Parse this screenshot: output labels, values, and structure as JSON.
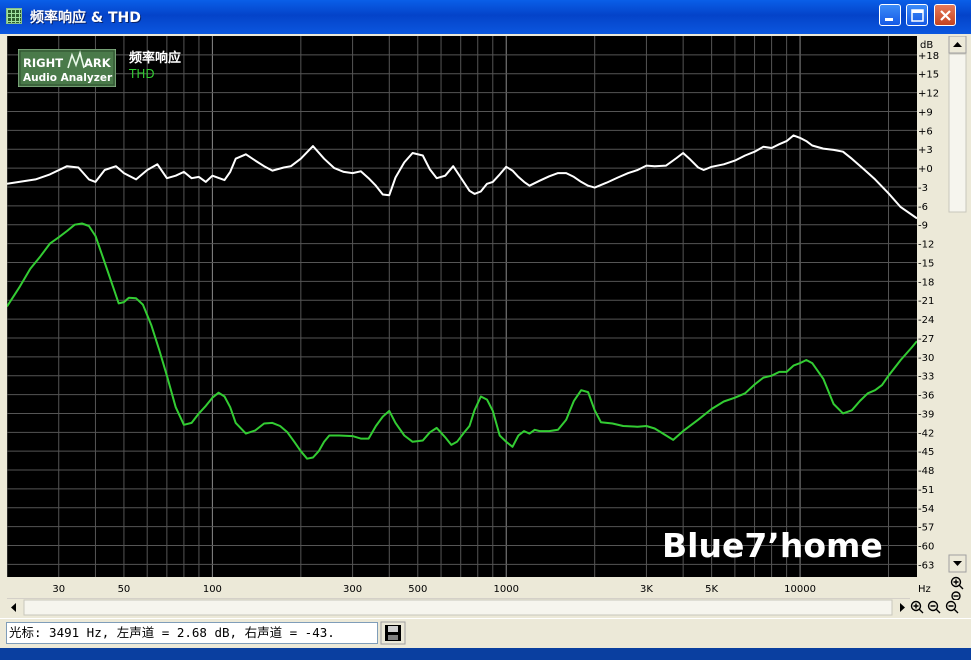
{
  "window": {
    "title": "频率响应 & THD",
    "buttons": {
      "minimize": "minimize",
      "maximize": "maximize",
      "close": "close"
    }
  },
  "logo": {
    "line1_a": "RIGHT",
    "line1_b": "ARK",
    "line2": "Audio Analyzer"
  },
  "watermark": "Blue7’home",
  "legend": {
    "fr_label": "频率响应",
    "thd_label": "THD"
  },
  "status": {
    "readout": "光标:  3491 Hz, 左声道 = 2.68 dB, 右声道 = -43.",
    "save_icon": "floppy-disk-icon"
  },
  "colors": {
    "background": "#000000",
    "grid": "#5a5a5a",
    "fr": "#ffffff",
    "thd": "#33cc33",
    "titlebar": "#0A5FE8"
  },
  "chart_data": {
    "type": "line",
    "x_scale": "log",
    "xlim": [
      20,
      25000
    ],
    "ylim": [
      -65,
      21
    ],
    "y_unit_label": "dB",
    "x_unit_label": "Hz",
    "grid": true,
    "x_tick_labels": [
      {
        "v": 30,
        "t": "30"
      },
      {
        "v": 50,
        "t": "50"
      },
      {
        "v": 100,
        "t": "100"
      },
      {
        "v": 300,
        "t": "300"
      },
      {
        "v": 500,
        "t": "500"
      },
      {
        "v": 1000,
        "t": "1000"
      },
      {
        "v": 3000,
        "t": "3K"
      },
      {
        "v": 5000,
        "t": "5K"
      },
      {
        "v": 10000,
        "t": "10000"
      }
    ],
    "y_tick_labels": [
      "+18",
      "+15",
      "+12",
      "+9",
      "+6",
      "+3",
      "+0",
      "-3",
      "-6",
      "-9",
      "-12",
      "-15",
      "-18",
      "-21",
      "-24",
      "-27",
      "-30",
      "-33",
      "-36",
      "-39",
      "-42",
      "-45",
      "-48",
      "-51",
      "-54",
      "-57",
      "-60",
      "-63"
    ],
    "y_tick_values": [
      18,
      15,
      12,
      9,
      6,
      3,
      0,
      -3,
      -6,
      -9,
      -12,
      -15,
      -18,
      -21,
      -24,
      -27,
      -30,
      -33,
      -36,
      -39,
      -42,
      -45,
      -48,
      -51,
      -54,
      -57,
      -60,
      -63
    ],
    "series": [
      {
        "name": "频率响应",
        "color": "#ffffff",
        "points": [
          [
            20,
            -2.5
          ],
          [
            25,
            -1.8
          ],
          [
            28,
            -1.0
          ],
          [
            32,
            0.3
          ],
          [
            35,
            0.1
          ],
          [
            38,
            -1.8
          ],
          [
            40,
            -2.2
          ],
          [
            43,
            -0.3
          ],
          [
            47,
            0.3
          ],
          [
            50,
            -0.8
          ],
          [
            55,
            -1.8
          ],
          [
            60,
            -0.3
          ],
          [
            65,
            0.6
          ],
          [
            70,
            -1.6
          ],
          [
            75,
            -1.2
          ],
          [
            80,
            -0.6
          ],
          [
            85,
            -1.6
          ],
          [
            90,
            -1.4
          ],
          [
            95,
            -2.2
          ],
          [
            100,
            -1.2
          ],
          [
            110,
            -1.9
          ],
          [
            115,
            -0.6
          ],
          [
            120,
            1.5
          ],
          [
            130,
            2.2
          ],
          [
            140,
            1.2
          ],
          [
            150,
            0.3
          ],
          [
            160,
            -0.4
          ],
          [
            175,
            0.1
          ],
          [
            185,
            0.3
          ],
          [
            200,
            1.5
          ],
          [
            220,
            3.5
          ],
          [
            240,
            1.5
          ],
          [
            260,
            0
          ],
          [
            280,
            -0.6
          ],
          [
            300,
            -0.8
          ],
          [
            320,
            -0.5
          ],
          [
            340,
            -1.6
          ],
          [
            360,
            -2.8
          ],
          [
            380,
            -4.2
          ],
          [
            400,
            -4.3
          ],
          [
            420,
            -1.5
          ],
          [
            450,
            0.9
          ],
          [
            480,
            2.4
          ],
          [
            520,
            2.0
          ],
          [
            550,
            -0.2
          ],
          [
            580,
            -1.6
          ],
          [
            620,
            -1.2
          ],
          [
            660,
            0.3
          ],
          [
            700,
            -1.5
          ],
          [
            750,
            -3.6
          ],
          [
            780,
            -4.1
          ],
          [
            820,
            -3.7
          ],
          [
            860,
            -2.5
          ],
          [
            900,
            -2.2
          ],
          [
            950,
            -1.0
          ],
          [
            1000,
            0.2
          ],
          [
            1050,
            -0.4
          ],
          [
            1100,
            -1.4
          ],
          [
            1150,
            -2.2
          ],
          [
            1200,
            -2.8
          ],
          [
            1300,
            -2.0
          ],
          [
            1400,
            -1.3
          ],
          [
            1500,
            -0.8
          ],
          [
            1600,
            -0.8
          ],
          [
            1700,
            -1.4
          ],
          [
            1800,
            -2.2
          ],
          [
            1900,
            -2.8
          ],
          [
            2000,
            -3.1
          ],
          [
            2200,
            -2.3
          ],
          [
            2400,
            -1.5
          ],
          [
            2600,
            -0.8
          ],
          [
            2800,
            -0.3
          ],
          [
            3000,
            0.4
          ],
          [
            3200,
            0.3
          ],
          [
            3500,
            0.4
          ],
          [
            3800,
            1.6
          ],
          [
            4000,
            2.4
          ],
          [
            4200,
            1.5
          ],
          [
            4500,
            0.1
          ],
          [
            4700,
            -0.3
          ],
          [
            5000,
            0.2
          ],
          [
            5500,
            0.6
          ],
          [
            6000,
            1.2
          ],
          [
            6500,
            2.0
          ],
          [
            7000,
            2.6
          ],
          [
            7500,
            3.4
          ],
          [
            8000,
            3.2
          ],
          [
            8500,
            3.8
          ],
          [
            9000,
            4.3
          ],
          [
            9500,
            5.2
          ],
          [
            10000,
            4.8
          ],
          [
            10500,
            4.3
          ],
          [
            11000,
            3.6
          ],
          [
            12000,
            3.1
          ],
          [
            13000,
            2.9
          ],
          [
            14000,
            2.6
          ],
          [
            15000,
            1.5
          ],
          [
            16500,
            -0.2
          ],
          [
            18000,
            -1.8
          ],
          [
            20000,
            -4.0
          ],
          [
            22000,
            -6.2
          ],
          [
            25000,
            -8.0
          ]
        ]
      },
      {
        "name": "THD",
        "color": "#33cc33",
        "points": [
          [
            20,
            -22.0
          ],
          [
            22,
            -19.0
          ],
          [
            24,
            -16.0
          ],
          [
            26,
            -14.0
          ],
          [
            28,
            -12.0
          ],
          [
            30,
            -11.0
          ],
          [
            32,
            -10.0
          ],
          [
            34,
            -9.0
          ],
          [
            36,
            -8.8
          ],
          [
            38,
            -9.2
          ],
          [
            40,
            -10.8
          ],
          [
            43,
            -15.0
          ],
          [
            46,
            -19.0
          ],
          [
            48,
            -21.5
          ],
          [
            50,
            -21.3
          ],
          [
            52,
            -20.6
          ],
          [
            55,
            -20.7
          ],
          [
            58,
            -21.7
          ],
          [
            62,
            -25.0
          ],
          [
            66,
            -29.0
          ],
          [
            70,
            -33.0
          ],
          [
            75,
            -38.0
          ],
          [
            80,
            -40.8
          ],
          [
            85,
            -40.5
          ],
          [
            90,
            -39.0
          ],
          [
            95,
            -37.8
          ],
          [
            100,
            -36.5
          ],
          [
            105,
            -35.7
          ],
          [
            110,
            -36.3
          ],
          [
            115,
            -38.0
          ],
          [
            120,
            -40.5
          ],
          [
            130,
            -42.2
          ],
          [
            140,
            -41.7
          ],
          [
            150,
            -40.6
          ],
          [
            160,
            -40.5
          ],
          [
            170,
            -41.0
          ],
          [
            180,
            -42.0
          ],
          [
            190,
            -43.5
          ],
          [
            200,
            -45.0
          ],
          [
            210,
            -46.2
          ],
          [
            220,
            -46.0
          ],
          [
            230,
            -45.0
          ],
          [
            240,
            -43.5
          ],
          [
            250,
            -42.5
          ],
          [
            270,
            -42.5
          ],
          [
            300,
            -42.6
          ],
          [
            320,
            -43.0
          ],
          [
            340,
            -43.0
          ],
          [
            360,
            -41.0
          ],
          [
            380,
            -39.5
          ],
          [
            400,
            -38.6
          ],
          [
            420,
            -40.5
          ],
          [
            450,
            -42.5
          ],
          [
            480,
            -43.5
          ],
          [
            520,
            -43.3
          ],
          [
            550,
            -42.0
          ],
          [
            580,
            -41.3
          ],
          [
            620,
            -42.8
          ],
          [
            650,
            -44.0
          ],
          [
            680,
            -43.5
          ],
          [
            720,
            -42.0
          ],
          [
            750,
            -41.0
          ],
          [
            780,
            -38.5
          ],
          [
            820,
            -36.3
          ],
          [
            860,
            -36.8
          ],
          [
            900,
            -38.6
          ],
          [
            950,
            -42.5
          ],
          [
            1000,
            -43.5
          ],
          [
            1050,
            -44.3
          ],
          [
            1100,
            -42.5
          ],
          [
            1150,
            -41.8
          ],
          [
            1200,
            -42.2
          ],
          [
            1250,
            -41.6
          ],
          [
            1300,
            -41.8
          ],
          [
            1400,
            -41.8
          ],
          [
            1500,
            -41.6
          ],
          [
            1600,
            -40.0
          ],
          [
            1700,
            -37.0
          ],
          [
            1800,
            -35.3
          ],
          [
            1900,
            -35.6
          ],
          [
            2000,
            -38.5
          ],
          [
            2100,
            -40.4
          ],
          [
            2300,
            -40.6
          ],
          [
            2500,
            -41.0
          ],
          [
            2800,
            -41.1
          ],
          [
            3000,
            -41.0
          ],
          [
            3200,
            -41.4
          ],
          [
            3500,
            -42.5
          ],
          [
            3700,
            -43.2
          ],
          [
            4000,
            -41.8
          ],
          [
            4500,
            -40.0
          ],
          [
            5000,
            -38.3
          ],
          [
            5500,
            -37.1
          ],
          [
            6000,
            -36.5
          ],
          [
            6500,
            -35.8
          ],
          [
            7000,
            -34.4
          ],
          [
            7500,
            -33.3
          ],
          [
            8000,
            -33.0
          ],
          [
            8500,
            -32.4
          ],
          [
            9000,
            -32.4
          ],
          [
            9500,
            -31.4
          ],
          [
            10000,
            -31.0
          ],
          [
            10500,
            -30.5
          ],
          [
            11000,
            -31.0
          ],
          [
            12000,
            -33.5
          ],
          [
            13000,
            -37.5
          ],
          [
            14000,
            -39.0
          ],
          [
            15000,
            -38.5
          ],
          [
            16000,
            -37.0
          ],
          [
            17000,
            -35.8
          ],
          [
            18000,
            -35.3
          ],
          [
            19000,
            -34.5
          ],
          [
            20000,
            -33.0
          ],
          [
            22000,
            -30.5
          ],
          [
            24000,
            -28.5
          ],
          [
            25000,
            -27.5
          ]
        ]
      }
    ]
  }
}
